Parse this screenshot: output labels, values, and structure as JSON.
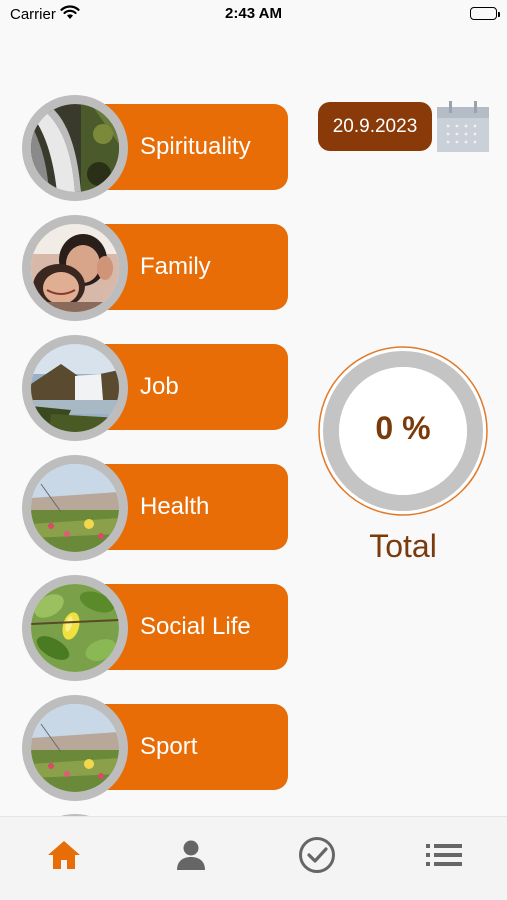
{
  "status_bar": {
    "carrier": "Carrier",
    "time": "2:43 AM"
  },
  "date": {
    "value": "20.9.2023",
    "calendar_icon": "calendar-icon"
  },
  "progress": {
    "value": "0 %",
    "label": "Total",
    "percent": 0
  },
  "categories": [
    {
      "label": "Spirituality",
      "photo": "waterfall-photo"
    },
    {
      "label": "Family",
      "photo": "family-selfie-photo"
    },
    {
      "label": "Job",
      "photo": "waterfall-landscape-photo"
    },
    {
      "label": "Health",
      "photo": "meadow-flowers-photo"
    },
    {
      "label": "Social Life",
      "photo": "lemon-tree-photo"
    },
    {
      "label": "Sport",
      "photo": "meadow-flowers-photo"
    }
  ],
  "tabbar": {
    "items": [
      {
        "name": "home",
        "icon": "home-icon",
        "active": true
      },
      {
        "name": "profile",
        "icon": "person-icon",
        "active": false
      },
      {
        "name": "check",
        "icon": "check-circle-icon",
        "active": false
      },
      {
        "name": "list",
        "icon": "list-icon",
        "active": false
      }
    ]
  },
  "colors": {
    "accent": "#e86d07",
    "dark_accent": "#8a3a08",
    "text_brown": "#7a3a0a",
    "ring_gray": "#bdbdbd"
  }
}
